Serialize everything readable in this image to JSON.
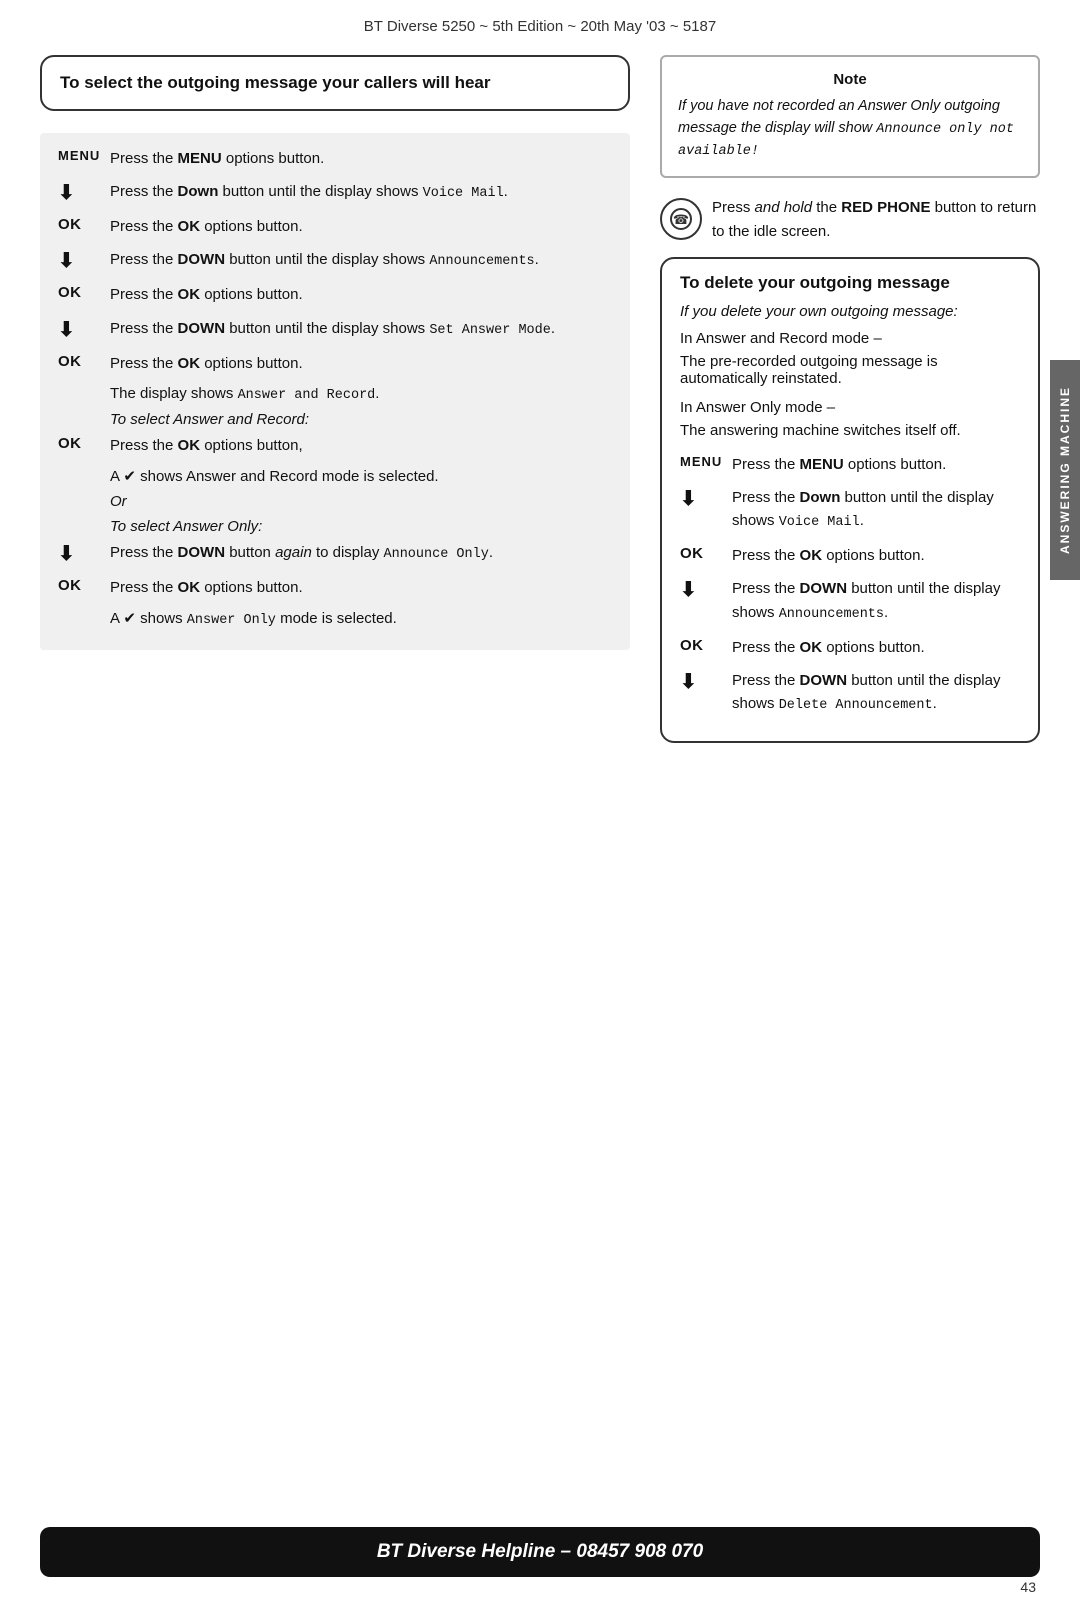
{
  "header": {
    "title": "BT Diverse 5250 ~ 5th Edition ~ 20th May '03 ~ 5187"
  },
  "left": {
    "box_title": "To select the outgoing message your callers will hear",
    "instructions": [
      {
        "label": "MENU",
        "type": "menu",
        "text": "Press the MENU options button.",
        "bold_words": [
          "MENU"
        ]
      },
      {
        "label": "↓",
        "type": "down",
        "text": "Press the Down button until the display shows Voice Mail.",
        "bold_words": [
          "Down"
        ]
      },
      {
        "label": "OK",
        "type": "ok",
        "text": "Press the OK options button.",
        "bold_words": [
          "OK"
        ]
      },
      {
        "label": "↓",
        "type": "down",
        "text": "Press the DOWN button until the display shows Announcements.",
        "bold_words": [
          "DOWN"
        ]
      },
      {
        "label": "OK",
        "type": "ok",
        "text": "Press the OK options button.",
        "bold_words": [
          "OK"
        ]
      },
      {
        "label": "↓",
        "type": "down",
        "text": "Press the DOWN button until the display shows Set Answer Mode.",
        "bold_words": [
          "DOWN"
        ]
      },
      {
        "label": "OK",
        "type": "ok",
        "text": "Press the OK options button."
      }
    ],
    "display_shows": "The display shows",
    "display_value": "Answer and Record.",
    "to_select_answer_record": "To select Answer and Record:",
    "ok_press_label": "OK",
    "ok_press_text": "Press the OK options button,",
    "check_shows": "A ✔ shows Answer and Record mode is selected.",
    "or": "Or",
    "to_select_answer_only": "To select Answer Only:",
    "down_again_text": "Press the DOWN button again to display Announce Only.",
    "ok_again_text": "Press the OK options button.",
    "check_only": "A ✔ shows Answer Only mode is selected."
  },
  "right": {
    "note_title": "Note",
    "note_text": "If you have not recorded an Answer Only outgoing message the display will show Announce only not available!",
    "phone_icon": "⊙",
    "phone_instruction": "Press and hold the RED PHONE button to return to the idle screen.",
    "delete_box_title": "To delete your outgoing message",
    "delete_intro": "If you delete your own outgoing message:",
    "answer_record_mode": "In Answer and Record mode –",
    "answer_record_desc": "The pre-recorded outgoing message is automatically reinstated.",
    "answer_only_mode": "In Answer Only mode –",
    "answer_only_desc": "The answering machine switches itself off.",
    "instructions2": [
      {
        "label": "MENU",
        "type": "menu",
        "text": "Press the MENU options button."
      },
      {
        "label": "↓",
        "type": "down",
        "text": "Press the Down button until the display shows Voice Mail."
      },
      {
        "label": "OK",
        "type": "ok",
        "text": "Press the OK options button."
      },
      {
        "label": "↓",
        "type": "down",
        "text": "Press the DOWN button until the display shows Announcements."
      },
      {
        "label": "OK",
        "type": "ok",
        "text": "Press the OK options button."
      },
      {
        "label": "↓",
        "type": "down",
        "text": "Press the DOWN button until the display shows Delete Announcement."
      }
    ]
  },
  "side_tab": "ANSWERING MACHINE",
  "bottom_bar": "BT Diverse Helpline – 08457 908 070",
  "page_number": "43"
}
